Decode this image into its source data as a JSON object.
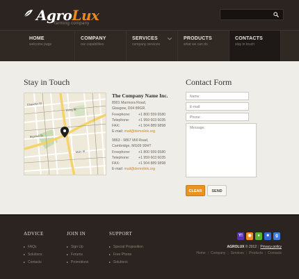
{
  "header": {
    "logo_main": "Agro",
    "logo_accent": "Lux",
    "tagline": "farming company",
    "search_placeholder": ""
  },
  "nav": [
    {
      "label": "HOME",
      "sub": "welcome page"
    },
    {
      "label": "COMPANY",
      "sub": "our capabilities"
    },
    {
      "label": "SERVICES",
      "sub": "company services"
    },
    {
      "label": "PRODUCTS",
      "sub": "what we can do"
    },
    {
      "label": "CONTACTS",
      "sub": "stay in touch"
    }
  ],
  "main": {
    "stay_title": "Stay in Touch",
    "contact_title": "Contact Form",
    "company_name": "The Company Name Inc.",
    "address1": {
      "street": "8901 Marmora Road,",
      "city": "Glasgow, D04 89GR.",
      "rows": [
        {
          "k": "Freephone:",
          "v": "+1 800 559 6580"
        },
        {
          "k": "Telephone:",
          "v": "+1 959 603 6035"
        },
        {
          "k": "FAX:",
          "v": "+1 504 889 9898"
        }
      ],
      "email_label": "E-mail:",
      "email": "mail@demolink.org"
    },
    "address2": {
      "street": "9863 - 9867 Mill Road,",
      "city": "Cambridge, MG09 99HT",
      "rows": [
        {
          "k": "Freephone:",
          "v": "+1 800 559 6580"
        },
        {
          "k": "Telephone:",
          "v": "+1 959 603 6035"
        },
        {
          "k": "FAX:",
          "v": "+1 504 889 9898"
        }
      ],
      "email_label": "E-mail:",
      "email": "mail@demolink.org"
    },
    "form": {
      "name_placeholder": "Name:",
      "email_placeholder": "E-mail:",
      "phone_placeholder": "Phone:",
      "message_placeholder": "Message:",
      "clear_label": "CLEAR",
      "send_label": "SEND"
    },
    "map_labels": [
      "Chandler St",
      "Irving St",
      "Bigelow St",
      "Main St"
    ]
  },
  "footer": {
    "cols": [
      {
        "title": "ADVICE",
        "items": [
          "FAQs",
          "Solutions",
          "Contacts"
        ]
      },
      {
        "title": "JOIN IN",
        "items": [
          "Sign Up",
          "Forums",
          "Promotions"
        ]
      },
      {
        "title": "SUPPORT",
        "items": [
          "Special Proposition",
          "Free Phone",
          "Solutions"
        ]
      }
    ],
    "brand": "AGROLUX",
    "copyright": "© 2012",
    "sep": "|",
    "privacy": "Privacy policy",
    "links": [
      "Home",
      "Company",
      "Services",
      "Products",
      "Contacts"
    ],
    "social": [
      {
        "icon": "yahoo-icon",
        "glyph": "Y!",
        "color": "#5b2fb2"
      },
      {
        "icon": "rss-icon",
        "glyph": "◉",
        "color": "#f08a1c"
      },
      {
        "icon": "chat-icon",
        "glyph": "●",
        "color": "#59b031"
      },
      {
        "icon": "delicious-icon",
        "glyph": "■",
        "color": "#2f6bd8"
      },
      {
        "icon": "google-icon",
        "glyph": "g",
        "color": "#3b7ee0"
      }
    ]
  },
  "colors": {
    "accent": "#e88b1e",
    "dark": "#2b2420"
  }
}
